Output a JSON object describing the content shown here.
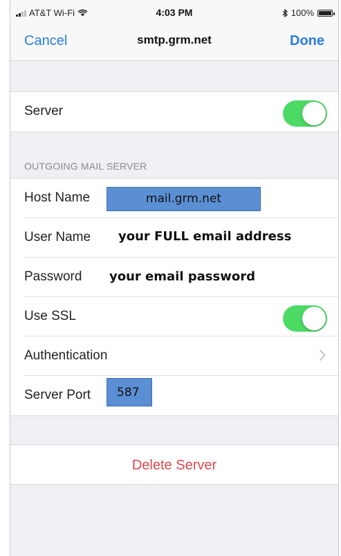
{
  "status_bar": {
    "carrier": "AT&T Wi-Fi",
    "time": "4:03 PM",
    "battery": "100%"
  },
  "nav": {
    "cancel_label": "Cancel",
    "title": "smtp.grm.net",
    "done_label": "Done"
  },
  "server_row": {
    "label": "Server",
    "enabled": true
  },
  "outgoing": {
    "header": "OUTGOING MAIL SERVER",
    "host_name": {
      "label": "Host Name",
      "value": "mail.grm.net"
    },
    "user_name": {
      "label": "User Name",
      "value": "your FULL email address"
    },
    "password": {
      "label": "Password",
      "value": "your email password"
    },
    "use_ssl": {
      "label": "Use SSL",
      "enabled": true
    },
    "authentication": {
      "label": "Authentication"
    },
    "server_port": {
      "label": "Server Port",
      "value": "587"
    }
  },
  "delete_server_label": "Delete Server",
  "colors": {
    "accent": "#2a7de1",
    "toggle_on": "#4cd964",
    "destructive": "#e0484f",
    "annotation_box": "#5b8fd3"
  }
}
